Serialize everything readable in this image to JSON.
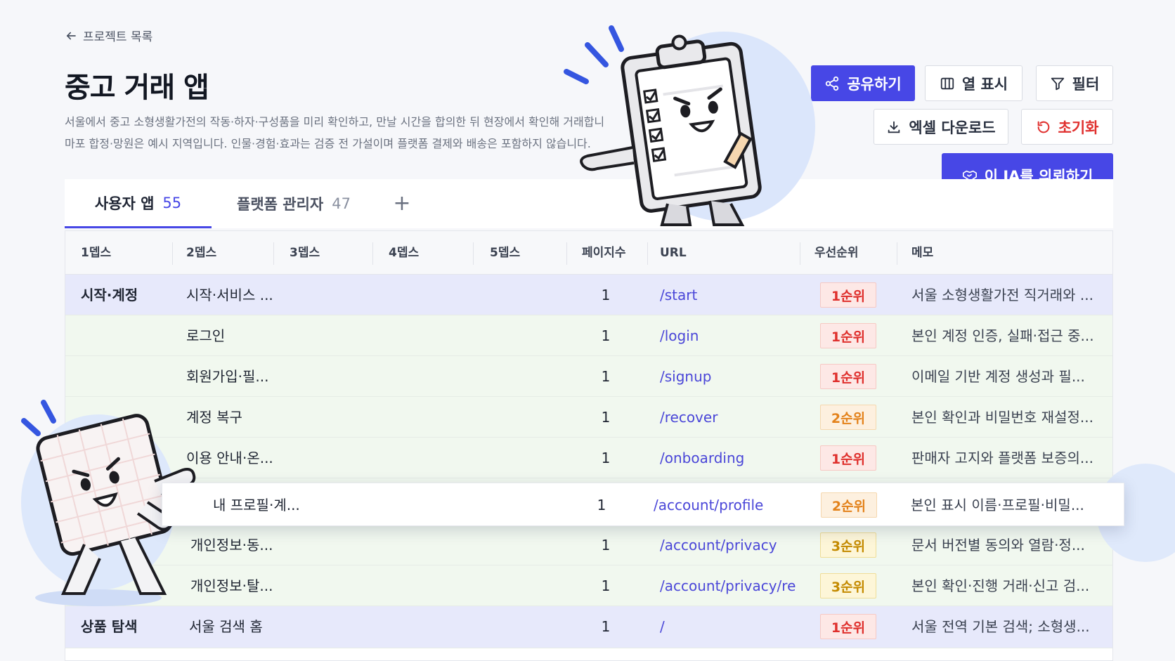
{
  "back_link": "프로젝트 목록",
  "title": "중고 거래 앱",
  "description": [
    "서울에서 중고 소형생활가전의 작동·하자·구성품을 미리 확인하고, 만날 시간을 합의한 뒤 현장에서 확인해 거래합니",
    "마포 합정·망원은 예시 지역입니다. 인물·경험·효과는 검증 전 가설이며 플랫폼 결제와 배송은 포함하지 않습니다."
  ],
  "buttons": {
    "share": "공유하기",
    "columns": "열 표시",
    "filter": "필터",
    "excel": "엑셀 다운로드",
    "reset": "초기화",
    "request": "이 IA를 의뢰하기"
  },
  "tabs": [
    {
      "name": "사용자 앱",
      "count": "55"
    },
    {
      "name": "플랫폼 관리자",
      "count": "47"
    }
  ],
  "tab_add": "+",
  "columns": [
    "1뎁스",
    "2뎁스",
    "3뎁스",
    "4뎁스",
    "5뎁스",
    "페이지수",
    "URL",
    "우선순위",
    "메모"
  ],
  "rows": [
    {
      "d1": "시작·계정",
      "d2": "시작·서비스 ...",
      "pages": "1",
      "url": "/start",
      "priority": "1순위",
      "memo": "서울 소형생활가전 직거래와 ..."
    },
    {
      "d1": "",
      "d2": "로그인",
      "pages": "1",
      "url": "/login",
      "priority": "1순위",
      "memo": "본인 계정 인증, 실패·접근 중..."
    },
    {
      "d1": "",
      "d2": "회원가입·필...",
      "pages": "1",
      "url": "/signup",
      "priority": "1순위",
      "memo": "이메일 기반 계정 생성과 필..."
    },
    {
      "d1": "",
      "d2": "계정 복구",
      "pages": "1",
      "url": "/recover",
      "priority": "2순위",
      "memo": "본인 확인과 비밀번호 재설정..."
    },
    {
      "d1": "",
      "d2": "이용 안내·온...",
      "pages": "1",
      "url": "/onboarding",
      "priority": "1순위",
      "memo": "판매자 고지와 플랫폼 보증의..."
    },
    {
      "d1": "",
      "d2": "내 프로필·계...",
      "pages": "1",
      "url": "/account/profile",
      "priority": "2순위",
      "memo": "본인 표시 이름·프로필·비밀..."
    },
    {
      "d1": "",
      "d2": "개인정보·동...",
      "pages": "1",
      "url": "/account/privacy",
      "priority": "3순위",
      "memo": "문서 버전별 동의와 열람·정..."
    },
    {
      "d1": "",
      "d2": "개인정보·탈...",
      "pages": "1",
      "url": "/account/privacy/re",
      "priority": "3순위",
      "memo": "본인 확인·진행 거래·신고 검..."
    },
    {
      "d1": "상품 탐색",
      "d2": "서울 검색 홈",
      "pages": "1",
      "url": "/",
      "priority": "1순위",
      "memo": "서울 전역 기본 검색; 소형생..."
    }
  ],
  "icons": {
    "back": "arrow-left-icon",
    "share": "share-icon",
    "columns": "columns-icon",
    "filter": "funnel-icon",
    "excel": "download-icon",
    "reset": "refresh-icon",
    "request": "handshake-icon"
  },
  "colors": {
    "accent": "#4747e6",
    "group_row": "#e7e9fb",
    "child_row": "#f1f8ef",
    "priority1": "#df2f2c",
    "priority2": "#e3821b",
    "priority3": "#c48a00"
  }
}
